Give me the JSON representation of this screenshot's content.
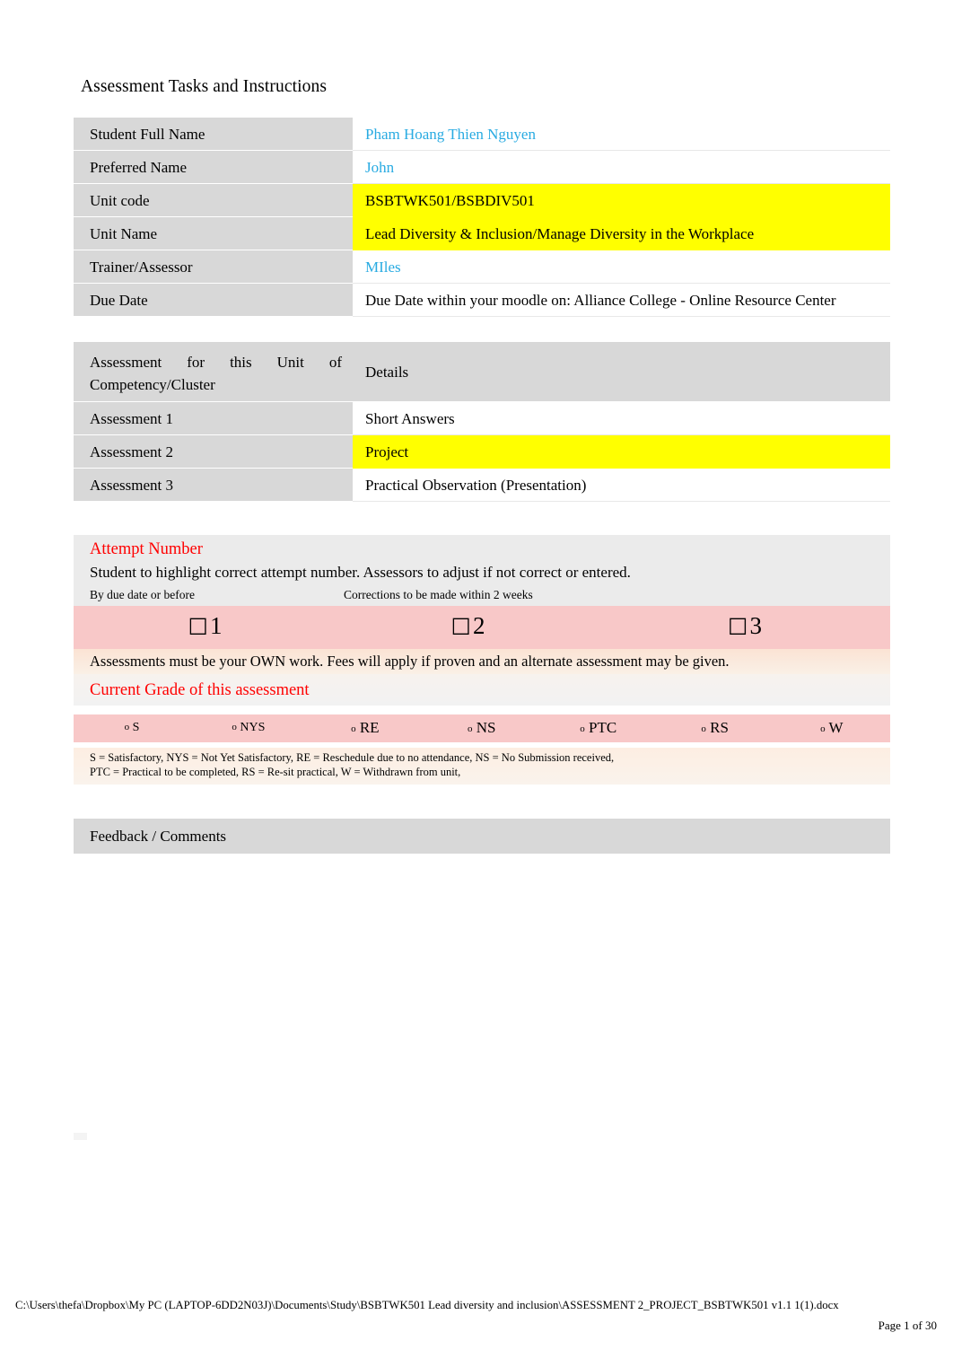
{
  "document": {
    "title": "Assessment Tasks and Instructions"
  },
  "colors": {
    "student_value_blue": "#29abe2",
    "highlight_yellow": "#ffff00",
    "heading_red": "#ff0000",
    "label_grey": "#d8d8d8",
    "attempt_pink": "#f8c8c8"
  },
  "student_details": {
    "rows": [
      {
        "label": "Student Full Name",
        "value": "Pham Hoang Thien Nguyen",
        "style": "blue"
      },
      {
        "label": "Preferred Name",
        "value": "John",
        "style": "blue"
      },
      {
        "label": "Unit code",
        "value": "BSBTWK501/BSBDIV501",
        "style": "highlight"
      },
      {
        "label": "Unit Name",
        "value": "Lead Diversity & Inclusion/Manage Diversity in the Workplace",
        "style": "highlight"
      },
      {
        "label": "Trainer/Assessor",
        "value": "MIles",
        "style": "blue"
      },
      {
        "label": "Due Date",
        "value": "Due Date within your moodle on: Alliance College - Online Resource Center",
        "style": "plain"
      }
    ]
  },
  "assessment_table": {
    "header_label": "Assessment for this Unit of Competency/Cluster",
    "header_label_line1": "Assessment for this Unit of",
    "header_label_line2": "Competency/Cluster",
    "header_details": "Details",
    "rows": [
      {
        "label": "Assessment 1",
        "value": "Short Answers",
        "style": "plain"
      },
      {
        "label": "Assessment 2",
        "value": "Project",
        "style": "highlight"
      },
      {
        "label": "Assessment 3",
        "value": "Practical Observation (Presentation)",
        "style": "plain"
      }
    ]
  },
  "attempt_section": {
    "heading": "Attempt Number",
    "instruction": "Student to highlight correct attempt number. Assessors to adjust if not correct or entered.",
    "col_note_1": "By due date or before",
    "col_note_2": "Corrections to be made within 2 weeks",
    "col_note_3": "",
    "checkbox_glyph": "☐",
    "attempts": [
      {
        "number": "1"
      },
      {
        "number": "2"
      },
      {
        "number": "3"
      }
    ],
    "own_work_note": "Assessments must be your OWN work. Fees will apply if proven and an alternate assessment may be given."
  },
  "grade_section": {
    "heading": "Current Grade of this assessment",
    "marker": "o",
    "options": [
      {
        "code": "S"
      },
      {
        "code": "NYS"
      },
      {
        "code": "RE"
      },
      {
        "code": "NS"
      },
      {
        "code": "PTC"
      },
      {
        "code": "RS"
      },
      {
        "code": "W"
      }
    ],
    "legend_line1": "S = Satisfactory, NYS = Not Yet Satisfactory, RE = Reschedule due to no attendance, NS = No Submission received,",
    "legend_line2": "PTC = Practical to be completed, RS = Re-sit practical, W = Withdrawn from unit,"
  },
  "feedback_section": {
    "heading": "Feedback / Comments",
    "body_value": ""
  },
  "footer": {
    "file_path": "C:\\Users\\thefa\\Dropbox\\My PC (LAPTOP-6DD2N03J)\\Documents\\Study\\BSBTWK501 Lead diversity and inclusion\\ASSESSMENT 2_PROJECT_BSBTWK501 v1.1 1(1).docx",
    "page_number": "Page 1 of 30"
  }
}
